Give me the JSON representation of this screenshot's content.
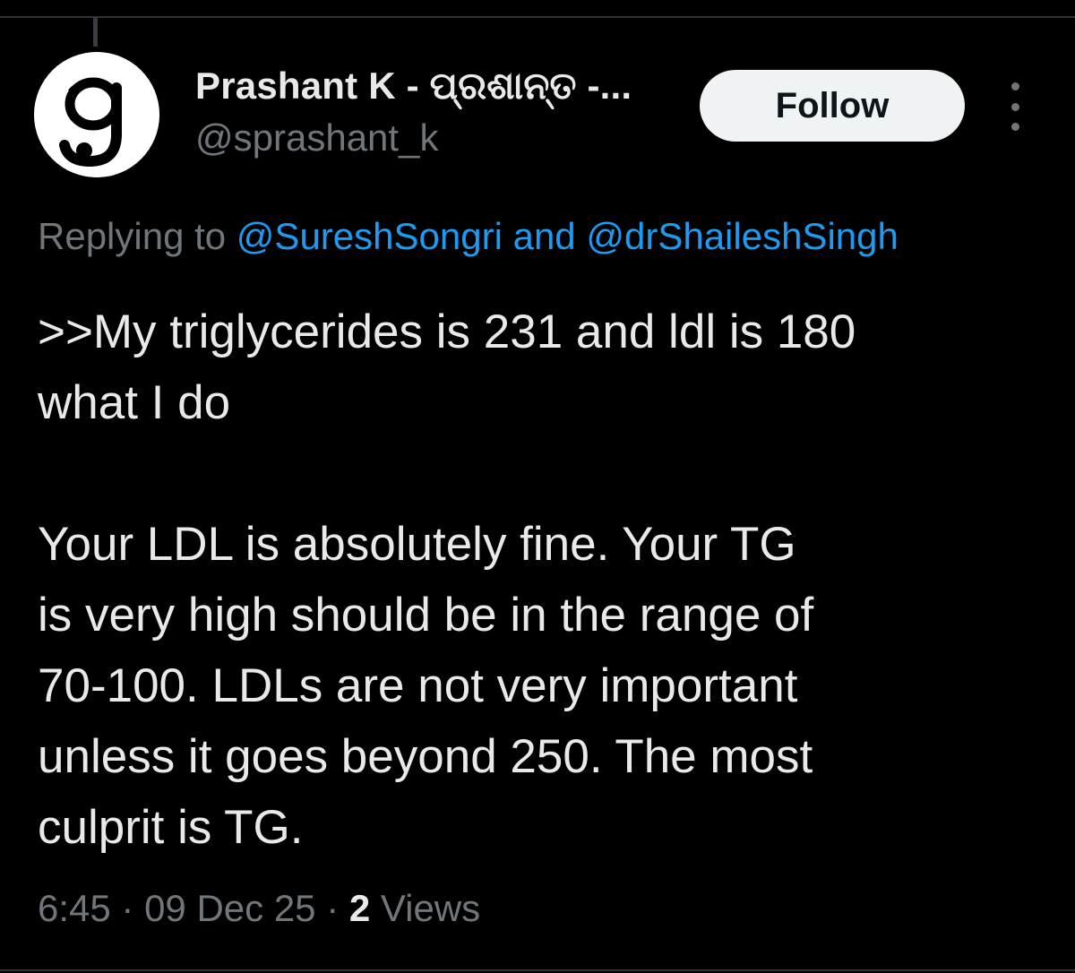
{
  "author": {
    "display_name": "Prashant K - ପ୍ରଶାନ୍ତ -...",
    "handle": "@sprashant_k",
    "avatar_icon": "letter-g-logo-icon"
  },
  "actions": {
    "follow_label": "Follow",
    "more_icon": "more-vertical-icon"
  },
  "reply": {
    "prefix": "Replying to ",
    "mention_1": "@SureshSongri",
    "conjunction": " and ",
    "mention_2": "@drShaileshSingh"
  },
  "tweet": {
    "lines": [
      ">>My triglycerides is 231 and ldl is 180",
      "what I do",
      "",
      "Your LDL is absolutely fine. Your TG",
      "is very high should be in the range of",
      "70-100. LDLs are not very important",
      "unless it goes beyond 250. The most",
      "culprit is TG."
    ]
  },
  "meta": {
    "time": "6:45",
    "separator": " · ",
    "date": "09 Dec 25",
    "views_count": "2",
    "views_label": " Views"
  },
  "colors": {
    "background": "#000000",
    "text": "#e7e9ea",
    "secondary": "#71767b",
    "link": "#1d9bf0",
    "button_bg": "#eff3f4"
  }
}
